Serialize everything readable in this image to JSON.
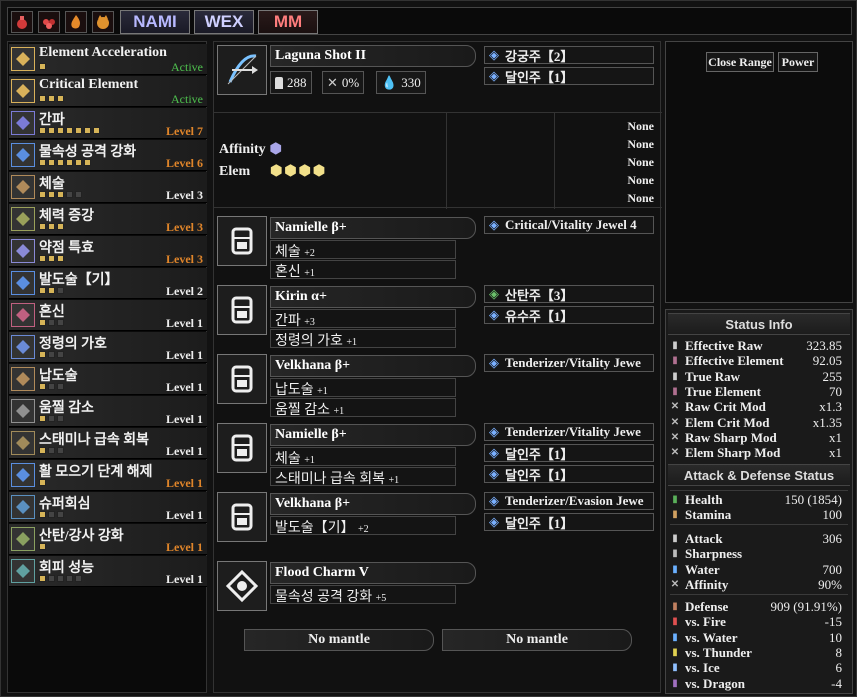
{
  "topbar": {
    "icons": [
      "red-bomb-icon",
      "red-dango-icon",
      "orange-flame-icon",
      "orange-cat-icon"
    ],
    "buttons": [
      "NAMI",
      "WEX",
      "MM"
    ],
    "button_colors": [
      "#b7b8ff",
      "#cfd0ff",
      "#ff7d7d"
    ]
  },
  "skills": [
    {
      "name": "Element Acceleration",
      "level": "Active",
      "status": "active",
      "pips": 1,
      "max": 1
    },
    {
      "name": "Critical Element",
      "level": "Active",
      "status": "active",
      "pips": 3,
      "max": 3
    },
    {
      "name": "간파",
      "level": "Level 7",
      "status": "max",
      "pips": 7,
      "max": 7
    },
    {
      "name": "물속성 공격 강화",
      "level": "Level 6",
      "status": "max",
      "pips": 6,
      "max": 6
    },
    {
      "name": "체술",
      "level": "Level 3",
      "status": "normal",
      "pips": 3,
      "max": 5
    },
    {
      "name": "체력 증강",
      "level": "Level 3",
      "status": "max",
      "pips": 3,
      "max": 3
    },
    {
      "name": "약점 특효",
      "level": "Level 3",
      "status": "max",
      "pips": 3,
      "max": 3
    },
    {
      "name": "발도술【기】",
      "level": "Level 2",
      "status": "normal",
      "pips": 2,
      "max": 3
    },
    {
      "name": "혼신",
      "level": "Level 1",
      "status": "normal",
      "pips": 1,
      "max": 3
    },
    {
      "name": "정령의 가호",
      "level": "Level 1",
      "status": "normal",
      "pips": 1,
      "max": 3
    },
    {
      "name": "납도술",
      "level": "Level 1",
      "status": "normal",
      "pips": 1,
      "max": 3
    },
    {
      "name": "움찔 감소",
      "level": "Level 1",
      "status": "normal",
      "pips": 1,
      "max": 3
    },
    {
      "name": "스태미나 급속 회복",
      "level": "Level 1",
      "status": "normal",
      "pips": 1,
      "max": 3
    },
    {
      "name": "활 모으기 단계 해제",
      "level": "Level 1",
      "status": "max",
      "pips": 1,
      "max": 1
    },
    {
      "name": "슈퍼회심",
      "level": "Level 1",
      "status": "normal",
      "pips": 1,
      "max": 3
    },
    {
      "name": "산탄/강사 강화",
      "level": "Level 1",
      "status": "max",
      "pips": 1,
      "max": 1
    },
    {
      "name": "회피 성능",
      "level": "Level 1",
      "status": "normal",
      "pips": 1,
      "max": 5
    }
  ],
  "weapon": {
    "name": "Laguna Shot II",
    "attack": "288",
    "affinity": "0%",
    "element": "330",
    "affinity_label": "Affinity",
    "elem_label": "Elem",
    "decorations": [
      "강궁주【2】",
      "달인주【1】"
    ],
    "rampage": [
      "None",
      "None",
      "None",
      "None",
      "None"
    ]
  },
  "armor": [
    {
      "name": "Namielle β+",
      "skills": [
        {
          "n": "체술",
          "l": "+2"
        },
        {
          "n": "혼신",
          "l": "+1"
        }
      ],
      "decos": [
        "Critical/Vitality Jewel 4"
      ]
    },
    {
      "name": "Kirin α+",
      "skills": [
        {
          "n": "간파",
          "l": "+3"
        },
        {
          "n": "정령의 가호",
          "l": "+1"
        }
      ],
      "decos": [
        "산탄주【3】",
        "유수주【1】"
      ]
    },
    {
      "name": "Velkhana β+",
      "skills": [
        {
          "n": "납도술",
          "l": "+1"
        },
        {
          "n": "움찔 감소",
          "l": "+1"
        }
      ],
      "decos": [
        "Tenderizer/Vitality Jewe"
      ]
    },
    {
      "name": "Namielle β+",
      "skills": [
        {
          "n": "체술",
          "l": "+1"
        },
        {
          "n": "스태미나 급속 회복",
          "l": "+1"
        }
      ],
      "decos": [
        "Tenderizer/Vitality Jewe",
        "달인주【1】",
        "달인주【1】"
      ]
    },
    {
      "name": "Velkhana β+",
      "skills": [
        {
          "n": "발도술【기】",
          "l": "+2"
        }
      ],
      "decos": [
        "Tenderizer/Evasion Jewe",
        "달인주【1】"
      ]
    }
  ],
  "charm": {
    "name": "Flood Charm V",
    "skills": [
      {
        "n": "물속성 공격 강화",
        "l": "+5"
      }
    ]
  },
  "mantles": [
    "No mantle",
    "No mantle"
  ],
  "conditions": [
    "Close Range",
    "Power"
  ],
  "status_info": {
    "title": "Status Info",
    "rows": [
      {
        "l": "Effective Raw",
        "v": "323.85"
      },
      {
        "l": "Effective Element",
        "v": "92.05"
      },
      {
        "l": "True Raw",
        "v": "255"
      },
      {
        "l": "True Element",
        "v": "70"
      },
      {
        "l": "Raw Crit Mod",
        "v": "x1.3"
      },
      {
        "l": "Elem Crit Mod",
        "v": "x1.35"
      },
      {
        "l": "Raw Sharp Mod",
        "v": "x1"
      },
      {
        "l": "Elem Sharp Mod",
        "v": "x1"
      }
    ]
  },
  "attack_defense": {
    "title": "Attack & Defense Status",
    "vitals": [
      {
        "l": "Health",
        "v": "150 (1854)"
      },
      {
        "l": "Stamina",
        "v": "100"
      }
    ],
    "offense": [
      {
        "l": "Attack",
        "v": "306"
      },
      {
        "l": "Sharpness",
        "v": ""
      },
      {
        "l": "Water",
        "v": "700"
      },
      {
        "l": "Affinity",
        "v": "90%"
      }
    ],
    "defense": [
      {
        "l": "Defense",
        "v": "909 (91.91%)"
      },
      {
        "l": "vs. Fire",
        "v": "-15"
      },
      {
        "l": "vs. Water",
        "v": "10"
      },
      {
        "l": "vs. Thunder",
        "v": "8"
      },
      {
        "l": "vs. Ice",
        "v": "6"
      },
      {
        "l": "vs. Dragon",
        "v": "-4"
      }
    ]
  }
}
